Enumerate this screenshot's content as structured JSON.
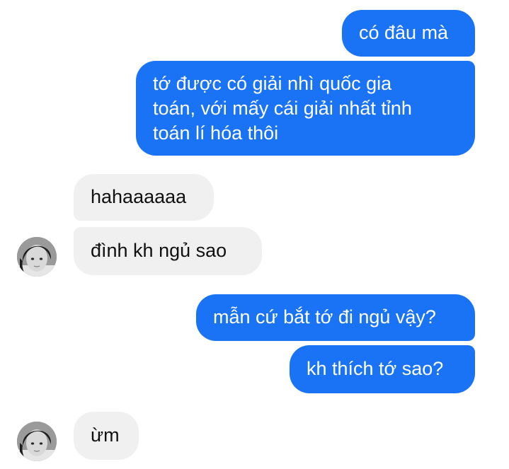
{
  "conversation": {
    "messages": [
      {
        "direction": "outgoing",
        "text": "có đâu mà"
      },
      {
        "direction": "outgoing",
        "text": "tớ được có giải nhì quốc gia toán, với mấy cái giải nhất tỉnh toán lí hóa thôi",
        "lines": [
          "tớ được có giải nhì quốc gia",
          "toán, với mấy cái giải nhất tỉnh",
          "toán lí hóa thôi"
        ]
      },
      {
        "direction": "incoming",
        "text": "hahaaaaaa"
      },
      {
        "direction": "incoming",
        "text": "đình kh ngủ sao"
      },
      {
        "direction": "outgoing",
        "text": "mẫn cứ bắt tớ đi ngủ vậy?"
      },
      {
        "direction": "outgoing",
        "text": "kh thích tớ sao?"
      },
      {
        "direction": "incoming",
        "text": "ừm"
      }
    ]
  },
  "colors": {
    "outgoing_bubble": "#1a73f5",
    "incoming_bubble": "#f0f0f0",
    "outgoing_text": "#ffffff",
    "incoming_text": "#111111"
  },
  "icons": {
    "contact_avatar": "contact-avatar-photo"
  }
}
